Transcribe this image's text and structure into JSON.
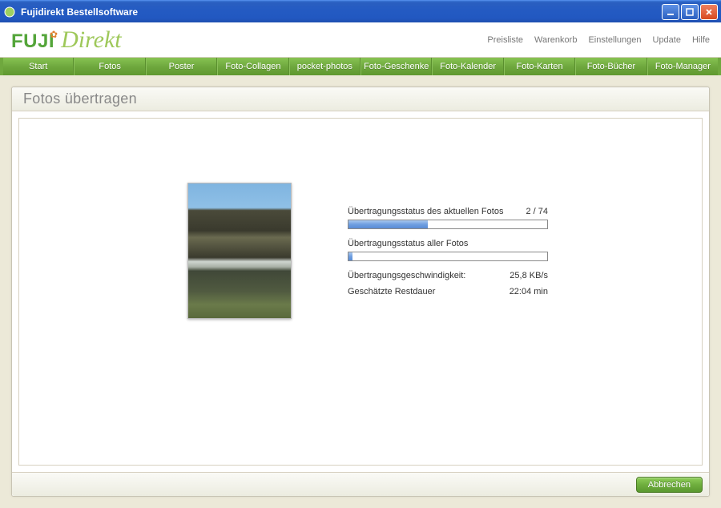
{
  "window": {
    "title": "Fujidirekt Bestellsoftware"
  },
  "logo": {
    "part1": "FUJI",
    "part2": "Direkt"
  },
  "header_links": [
    "Preisliste",
    "Warenkorb",
    "Einstellungen",
    "Update",
    "Hilfe"
  ],
  "nav": [
    "Start",
    "Fotos",
    "Poster",
    "Foto-Collagen",
    "pocket-photos",
    "Foto-Geschenke",
    "Foto-Kalender",
    "Foto-Karten",
    "Foto-Bücher",
    "Foto-Manager"
  ],
  "panel": {
    "title": "Fotos übertragen"
  },
  "transfer": {
    "current_label": "Übertragungsstatus des aktuellen Fotos",
    "current_counter": "2 / 74",
    "current_percent": 40,
    "all_label": "Übertragungsstatus aller Fotos",
    "all_percent": 2,
    "speed_label": "Übertragungsgeschwindigkeit:",
    "speed_value": "25,8 KB/s",
    "eta_label": "Geschätzte Restdauer",
    "eta_value": "22:04 min"
  },
  "buttons": {
    "cancel": "Abbrechen"
  }
}
